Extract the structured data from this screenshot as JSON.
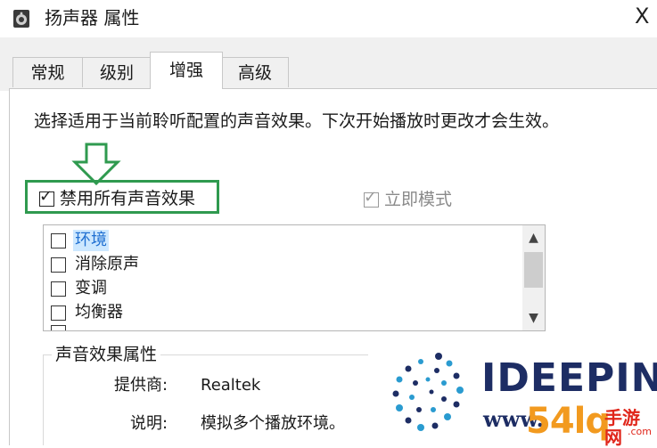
{
  "window": {
    "title": "扬声器 属性",
    "close_glyph": "X"
  },
  "tabs": [
    {
      "label": "常规"
    },
    {
      "label": "级别"
    },
    {
      "label": "增强",
      "active": true
    },
    {
      "label": "高级"
    }
  ],
  "enhancements": {
    "description": "选择适用于当前聆听配置的声音效果。下次开始播放时更改才会生效。",
    "disable_all_label": "禁用所有声音效果",
    "disable_all_checked": true,
    "immediate_mode_label": "立即模式",
    "immediate_mode_checked": true,
    "immediate_mode_disabled": true,
    "effects": [
      {
        "label": "环境",
        "checked": false,
        "selected": true
      },
      {
        "label": "消除原声",
        "checked": false
      },
      {
        "label": "变调",
        "checked": false
      },
      {
        "label": "均衡器",
        "checked": false
      }
    ]
  },
  "properties": {
    "group_title": "声音效果属性",
    "provider_label": "提供商:",
    "provider_value": "Realtek",
    "description_label": "说明:",
    "description_value": "模拟多个播放环境。"
  },
  "watermark": {
    "brand": "IDEEPIN",
    "url": "www.",
    "site_digits": "54lq",
    "site_sub": "手游网",
    "site_sub2": ".com"
  },
  "colors": {
    "highlight_green": "#2f9a4f",
    "selection_blue": "#1f6fd1",
    "selection_bg": "#cde8ff"
  }
}
